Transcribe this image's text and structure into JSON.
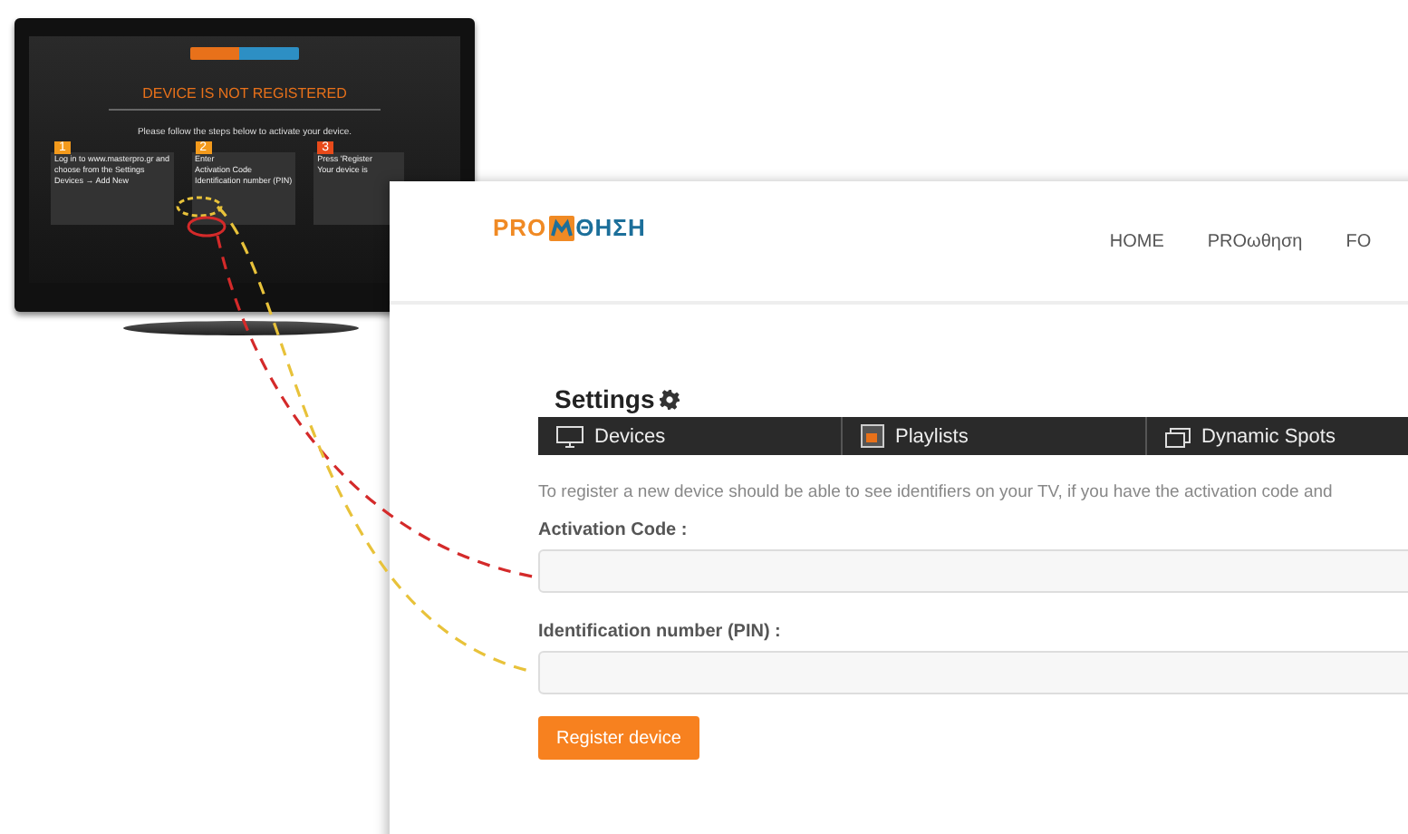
{
  "tv": {
    "title": "DEVICE IS NOT REGISTERED",
    "instruction": "Please follow the steps below to activate your device.",
    "steps": [
      {
        "number": "1",
        "lines": [
          "Log in to www.masterpro.gr and",
          "choose from the Settings",
          "Devices → Add New"
        ]
      },
      {
        "number": "2",
        "lines": [
          "Enter",
          "Activation Code",
          "Identification number (PIN)"
        ]
      },
      {
        "number": "3",
        "lines": [
          "Press 'Register",
          "Your device is"
        ]
      }
    ]
  },
  "logo": {
    "left": "PRO",
    "right": "ΘΗΣΗ"
  },
  "nav": [
    "HOME",
    "PROωθηση",
    "FO"
  ],
  "settings": {
    "title": "Settings",
    "tabs": [
      {
        "label": "Devices",
        "kind": "monitor"
      },
      {
        "label": "Playlists",
        "kind": "playlist"
      },
      {
        "label": "Dynamic Spots",
        "kind": "windows"
      }
    ],
    "description": "To register a new device should be able to see identifiers on your TV, if you have the activation code and",
    "fields": [
      {
        "label": "Activation Code :"
      },
      {
        "label": "Identification number (PIN) :"
      }
    ],
    "button": "Register device"
  }
}
